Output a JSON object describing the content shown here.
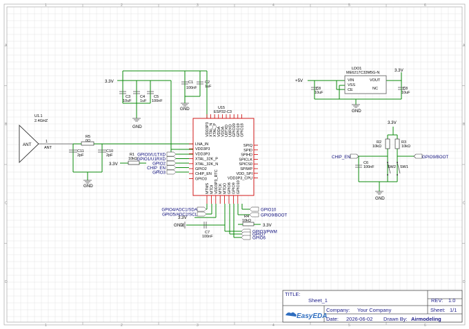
{
  "frame": {
    "cols": [
      "1",
      "2",
      "3",
      "4",
      "5",
      "6"
    ],
    "rows": [
      "A",
      "B",
      "C",
      "D"
    ]
  },
  "title_block": {
    "title_label": "TITLE:",
    "title": "Sheet_1",
    "rev_label": "REV:",
    "rev": "1.0",
    "company_label": "Company:",
    "company": "Your Company",
    "sheet_label": "Sheet:",
    "sheet": "1/1",
    "date_label": "Date:",
    "date": "2026-06-02",
    "drawn_label": "Drawn By:",
    "drawn": "Airmodeling",
    "logo": "EasyEDA"
  },
  "antenna": {
    "ref": "U1.1",
    "value": "2.4GHZ",
    "symbol": "ANT",
    "pin_num": "1",
    "pin_name": "ANT"
  },
  "r5": {
    "ref": "R5",
    "value": "0Ω"
  },
  "c11": {
    "ref": "C11",
    "value": "2pF"
  },
  "c10": {
    "ref": "C10",
    "value": "2pF"
  },
  "r1": {
    "ref": "R1",
    "value": "10kΩ"
  },
  "caps_top": {
    "c3": {
      "ref": "C3",
      "value": "10uF"
    },
    "c4": {
      "ref": "C4",
      "value": "1uF"
    },
    "c5": {
      "ref": "C5",
      "value": "100nF"
    },
    "c1": {
      "ref": "C1",
      "value": "100nF"
    },
    "c2": {
      "ref": "C2",
      "value": "1uF"
    },
    "c7": {
      "ref": "C7",
      "value": "100nF"
    }
  },
  "power": {
    "v33": "3.3V",
    "v5": "+5V",
    "gnd": "GND"
  },
  "u15": {
    "ref": "U15",
    "value": "ESP32-C3",
    "left_pins": [
      "LNA_IN",
      "VDD3P3",
      "VDD3P3",
      "XTAL_32K_P",
      "XTAL_32K_N",
      "GPIO2",
      "CHIP_EN",
      "GPIO3"
    ],
    "top_pins": [
      "VDD3P3",
      "XTAL_N",
      "XTAL_P",
      "VDDA",
      "VDDA",
      "U0TXD",
      "U0RXD",
      "GPIO20",
      "GPIO19",
      "GPIO18"
    ],
    "right_pins": [
      "SPIQ",
      "SPID",
      "SPIHD",
      "SPICLK",
      "SPICS0",
      "SPIWP",
      "VDD_SPI",
      "VDD3P3_CPU"
    ],
    "bottom_pins": [
      "MTMS",
      "MTDI",
      "VDD3P3_RTC",
      "MTCK",
      "MTDO",
      "GPIO8",
      "GPIO9",
      "GPIO10"
    ]
  },
  "nets_left": [
    "GPIO0/U1TXD",
    "GPIO1/U1RXD",
    "GPIO2",
    "CHIP_EN",
    "GPIO3"
  ],
  "nets_bottom_left": [
    "GPIO4/ADC1/SDA",
    "GPIO5/ADC2/SCL"
  ],
  "nets_bottom_right": [
    "GPIO10",
    "GPIO9/BOOT",
    "GPIO3/PWM",
    "GPIO7",
    "GPIO6"
  ],
  "r4": {
    "ref": "R4",
    "value": "10kΩ"
  },
  "ldo": {
    "ref": "LDO1",
    "value": "ME6217C33M5G-N",
    "pins": [
      "VIN",
      "VSS",
      "CE",
      "VOUT",
      "NC"
    ],
    "c8a": {
      "ref": "C8",
      "value": "10uF"
    },
    "c8b": {
      "ref": "C8",
      "value": "10uF"
    }
  },
  "switches": {
    "r2": {
      "ref": "R2",
      "value": "10kΩ"
    },
    "r3": {
      "ref": "R3",
      "value": "10kΩ"
    },
    "c6": {
      "ref": "C6",
      "value": "100nF"
    },
    "sw2": "SW2",
    "sw1": "SW1",
    "net_chip_en": "CHIP_EN",
    "net_boot": "GPIO9/BOOT"
  }
}
